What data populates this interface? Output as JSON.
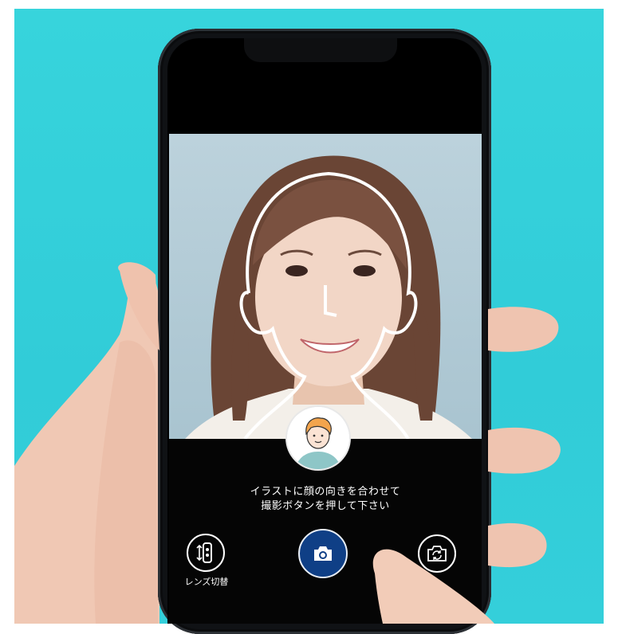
{
  "instruction": {
    "line1": "イラストに顔の向きを合わせて",
    "line2": "撮影ボタンを押して下さい"
  },
  "controls": {
    "lens_switch_label": "レンズ切替",
    "lens_switch_icon": "lens-switch-icon",
    "shutter_icon": "camera-icon",
    "flip_icon": "flip-camera-icon"
  },
  "colors": {
    "background": "#35d0da",
    "shutter": "#0f3f86",
    "guide_outline": "#ffffff"
  }
}
